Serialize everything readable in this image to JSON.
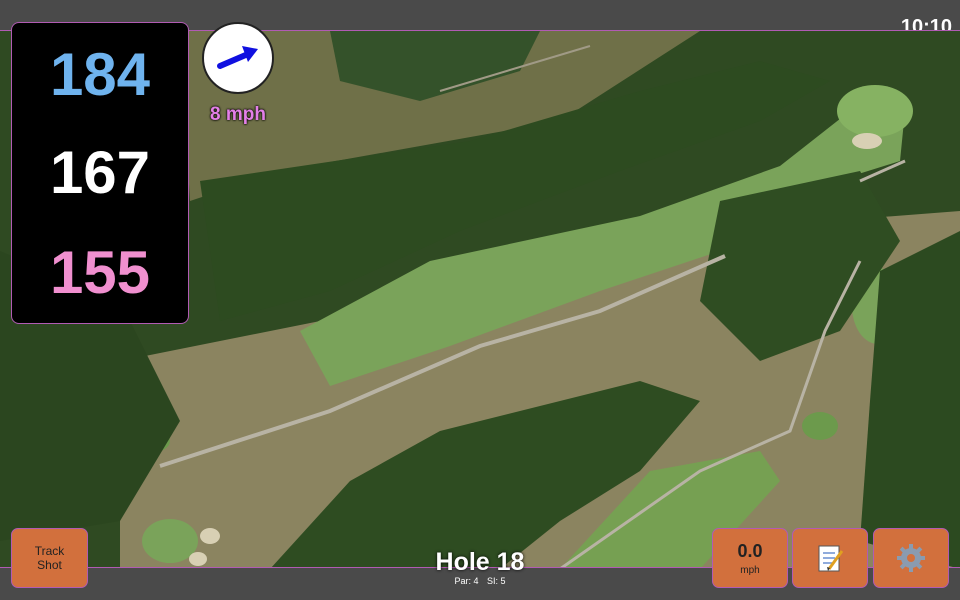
{
  "status": {
    "time": "10:10"
  },
  "distances": {
    "back": {
      "value": "184",
      "color": "#6fb3ee"
    },
    "middle": {
      "value": "167",
      "color": "#ffffff"
    },
    "front": {
      "value": "155",
      "color": "#f08fcf"
    }
  },
  "wind": {
    "speed_label": "8 mph",
    "arrow_icon": "wind-arrow-icon",
    "arrow_color": "#1010e0"
  },
  "buttons": {
    "track_shot": "Track\nShot",
    "speed_value": "0.0",
    "speed_unit": "mph",
    "notes_icon": "notepad-icon",
    "settings_icon": "gear-icon"
  },
  "hole": {
    "title": "Hole 18",
    "par": "Par: 4",
    "si": "SI: 5"
  },
  "colors": {
    "button": "#d2703d",
    "bar": "#4a4a4a",
    "accent_border": "#b15bb3"
  }
}
